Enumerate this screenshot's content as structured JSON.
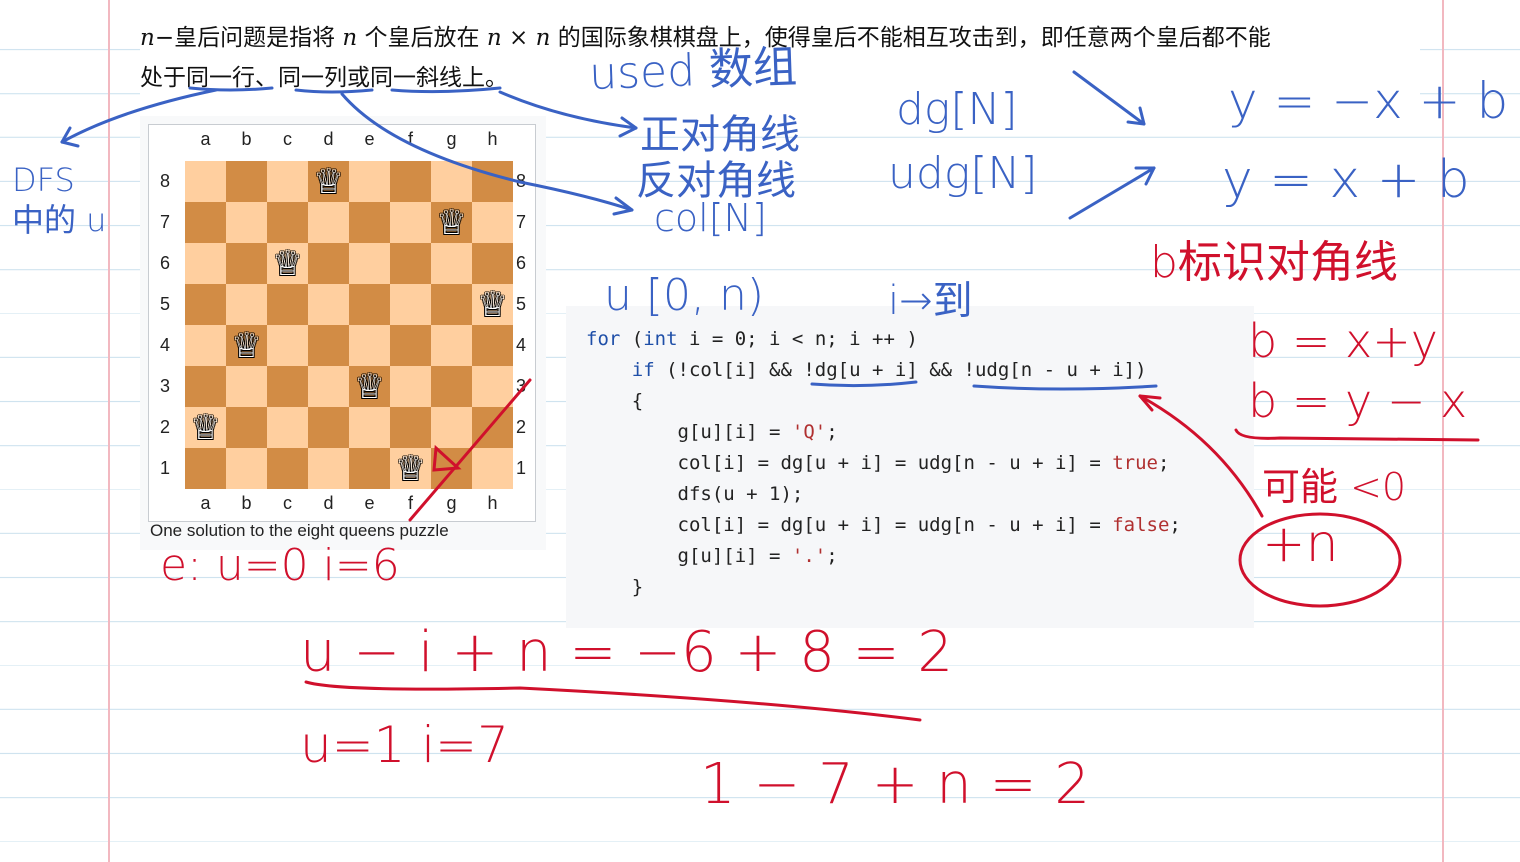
{
  "intro": {
    "line1_a": "n",
    "line1_b": "−皇后问题是指将 ",
    "line1_c": "n",
    "line1_d": " 个皇后放在 ",
    "line1_e": "n × n",
    "line1_f": " 的国际象棋棋盘上，使得皇后不能相互攻击到，即任意两个皇后都不能",
    "line2_a": "处于",
    "line2_b": "同一行",
    "line2_c": "、",
    "line2_d": "同一列",
    "line2_e": "或",
    "line2_f": "同一斜线",
    "line2_g": "上。"
  },
  "figure": {
    "files": [
      "a",
      "b",
      "c",
      "d",
      "e",
      "f",
      "g",
      "h"
    ],
    "ranks": [
      "8",
      "7",
      "6",
      "5",
      "4",
      "3",
      "2",
      "1"
    ],
    "queen_cols_by_rank_top_to_bottom": [
      3,
      6,
      2,
      7,
      1,
      4,
      0,
      5
    ],
    "queen_glyph": "♕",
    "caption": "One solution to the eight queens puzzle"
  },
  "code": {
    "lines": [
      "for (int i = 0; i < n; i ++ )",
      "    if (!col[i] && !dg[u + i] && !udg[n - u + i])",
      "    {",
      "        g[u][i] = 'Q';",
      "        col[i] = dg[u + i] = udg[n - u + i] = true;",
      "        dfs(u + 1);",
      "        col[i] = dg[u + i] = udg[n - u + i] = false;",
      "        g[u][i] = '.';",
      "    }"
    ]
  },
  "notes": {
    "dfs_order": "DFS 中的 u",
    "used_array": "used 数组",
    "main_diag": "正对角线",
    "anti_diag": "反对角线",
    "col": "col[N]",
    "dg": "dg[N]",
    "udg": "udg[N]",
    "eq1": "y = −x + b",
    "eq2": "y = x + b",
    "b_meaning": "b标识对角线",
    "range": "u [0, n)",
    "i_to": "i→到",
    "b_xy": "b = x+y",
    "b_yx": "b = y − x",
    "maybe_neg": "可能 <0",
    "plus_n": "+n",
    "example": "e:  u=0  i=6",
    "calc1": "u − i + n = −6 + 8 = 2",
    "ex2": "u=1  i=7",
    "calc2": "1 − 7 + n = 2"
  },
  "colors": {
    "blue_ink": "#3a62c4",
    "red_ink": "#d0102c",
    "light_square": "#ffcf9f",
    "dark_square": "#d28c45",
    "code_keyword": "#1f4fa8",
    "code_value": "#b03030"
  }
}
